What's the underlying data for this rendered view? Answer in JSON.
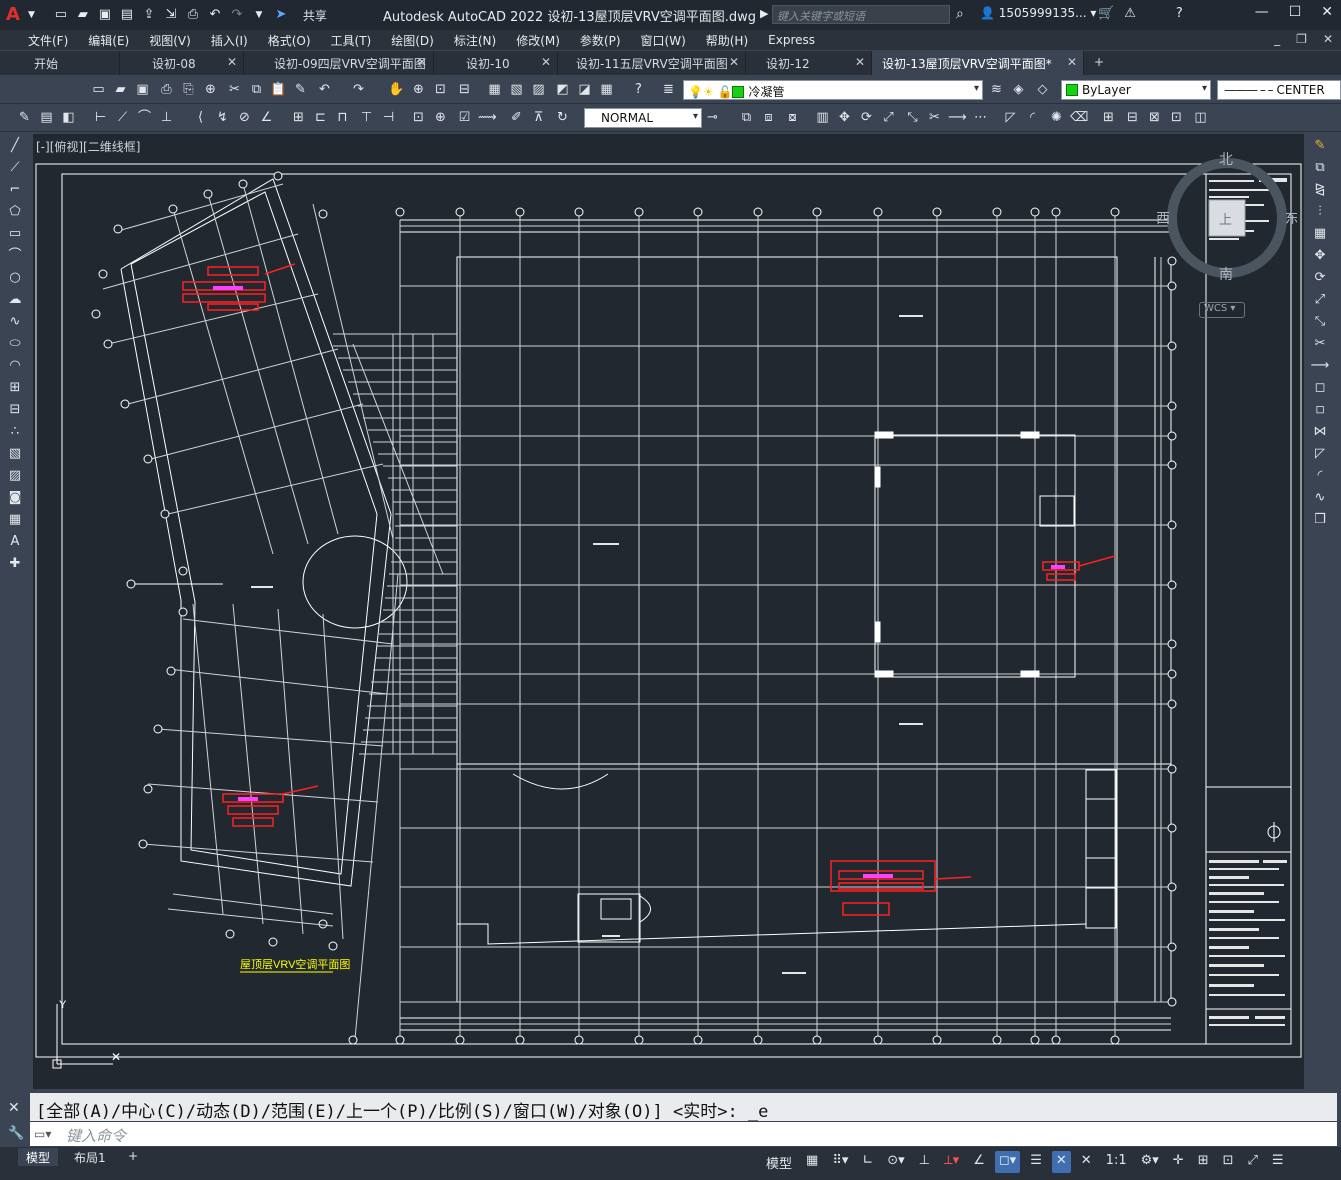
{
  "titlebar": {
    "app_logo": "A",
    "share_label": "共享",
    "title": "Autodesk AutoCAD 2022    设初-13屋顶层VRV空调平面图.dwg",
    "search_placeholder": "键入关键字或短语",
    "user": "1505999135...",
    "quick_access_icons": [
      "new-icon",
      "open-icon",
      "save-icon",
      "saveas-icon",
      "upload-icon",
      "export-icon",
      "print-icon",
      "undo-icon",
      "redo-icon",
      "share-icon"
    ]
  },
  "menubar": {
    "items": [
      "文件(F)",
      "编辑(E)",
      "视图(V)",
      "插入(I)",
      "格式(O)",
      "工具(T)",
      "绘图(D)",
      "标注(N)",
      "修改(M)",
      "参数(P)",
      "窗口(W)",
      "帮助(H)",
      "Express"
    ]
  },
  "tabs": [
    {
      "label": "开始",
      "closable": false
    },
    {
      "label": "设初-08",
      "closable": true
    },
    {
      "label": "设初-09四层VRV空调平面图",
      "closable": true
    },
    {
      "label": "设初-10",
      "closable": true
    },
    {
      "label": "设初-11五层VRV空调平面图",
      "closable": true
    },
    {
      "label": "设初-12",
      "closable": true
    },
    {
      "label": "设初-13屋顶层VRV空调平面图*",
      "closable": true,
      "active": true
    }
  ],
  "toolbar1": {
    "layer_dropdown": "冷凝管",
    "color_dropdown": "ByLayer",
    "linetype_dropdown": "CENTER"
  },
  "toolbar2": {
    "style_dropdown": "NORMAL"
  },
  "viewport": {
    "view_label": "[-][俯视][二维线框]",
    "compass": {
      "north": "北",
      "south": "南",
      "east": "东",
      "west": "西",
      "top": "上"
    },
    "wcs_label": "WCS",
    "drawing_title": "屋顶层VRV空调平面图"
  },
  "command": {
    "history": "[全部(A)/中心(C)/动态(D)/范围(E)/上一个(P)/比例(S)/窗口(W)/对象(O)] <实时>: _e",
    "placeholder": "键入命令"
  },
  "statusbar": {
    "layout_tabs": [
      "模型",
      "布局1"
    ],
    "model_label": "模型",
    "scale": "1:1"
  },
  "colors": {
    "drawing_bg": "#212830",
    "line": "#ffffff",
    "equipment": "#ff2020",
    "accent_magenta": "#ff40ff",
    "title_yellow": "#ffff00"
  }
}
